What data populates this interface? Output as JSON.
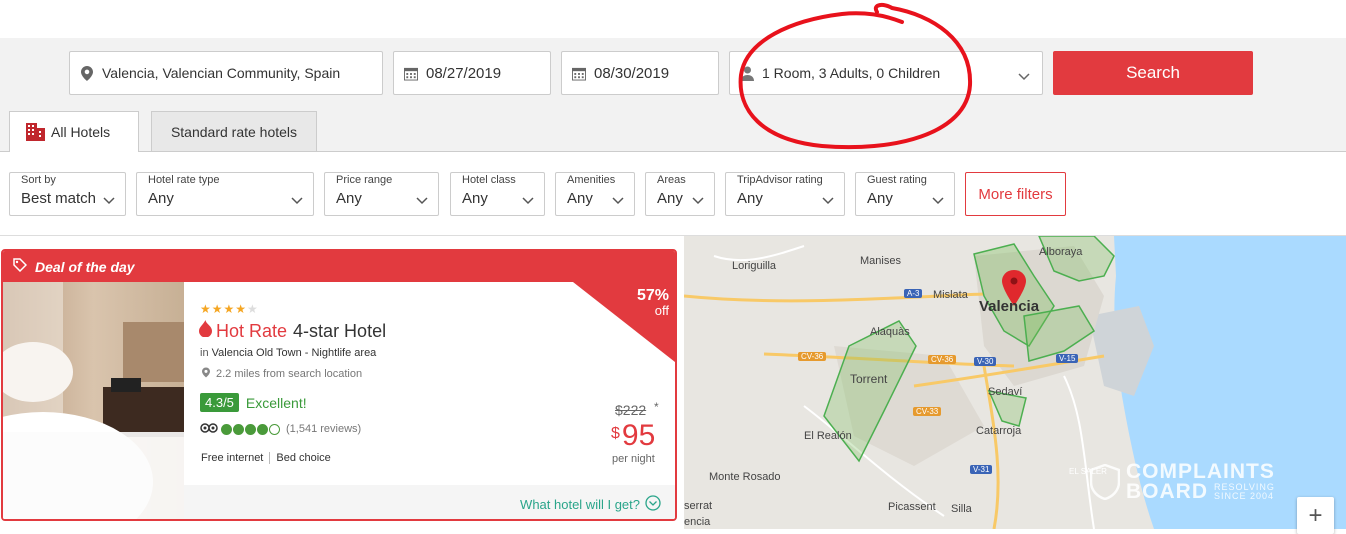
{
  "search": {
    "location": "Valencia, Valencian Community, Spain",
    "checkin": "08/27/2019",
    "checkout": "08/30/2019",
    "guests": "1 Room, 3 Adults, 0 Children",
    "button": "Search"
  },
  "tabs": [
    {
      "label": "All Hotels",
      "active": true
    },
    {
      "label": "Standard rate hotels",
      "active": false
    }
  ],
  "filters": [
    {
      "label": "Sort by",
      "value": "Best match"
    },
    {
      "label": "Hotel rate type",
      "value": "Any"
    },
    {
      "label": "Price range",
      "value": "Any"
    },
    {
      "label": "Hotel class",
      "value": "Any"
    },
    {
      "label": "Amenities",
      "value": "Any"
    },
    {
      "label": "Areas",
      "value": "Any"
    },
    {
      "label": "TripAdvisor rating",
      "value": "Any"
    },
    {
      "label": "Guest rating",
      "value": "Any"
    }
  ],
  "more_filters": "More filters",
  "deal": {
    "header": "Deal of the day",
    "discount_pct": "57%",
    "discount_off": "off",
    "stars_filled": 4,
    "stars_total": 5,
    "rate_type": "Hot Rate",
    "hotel_class": "4-star Hotel",
    "location_prefix": "in",
    "location_name": "Valencia Old Town - Nightlife area",
    "distance": "2.2 miles from search location",
    "score": "4.3/5",
    "score_label": "Excellent!",
    "ta_rating": 4,
    "reviews": "(1,541 reviews)",
    "amenities": [
      "Free internet",
      "Bed choice"
    ],
    "price_old": "$222",
    "price_old_mark": "*",
    "currency": "$",
    "price_new": "95",
    "per_night": "per night",
    "what_link": "What hotel will I get?"
  },
  "map": {
    "labels": [
      "Loriguilla",
      "Manises",
      "Mislata",
      "Alboraya",
      "Alaquàs",
      "Torrent",
      "Sedaví",
      "Catarroja",
      "El Realón",
      "Monte Rosado",
      "Picassent",
      "Silla",
      "serrat",
      "encia",
      "EL SALER"
    ],
    "city": "Valencia",
    "roads": [
      "A-3",
      "CV-36",
      "CV-36",
      "V-30",
      "V-15",
      "CV-33",
      "V-31"
    ]
  },
  "watermark": {
    "line1": "COMPLAINTS",
    "line2": "BOARD",
    "line3": "RESOLVING",
    "line4": "SINCE 2004"
  },
  "colors": {
    "accent": "#e23a3f",
    "success": "#3a9a3a",
    "link": "#2aa58a"
  }
}
